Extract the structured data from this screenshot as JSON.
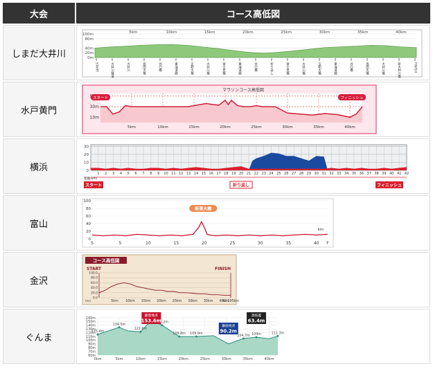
{
  "header": {
    "col_event": "大会",
    "col_course": "コース高低図"
  },
  "rows": [
    {
      "name": "しまだ大井川"
    },
    {
      "name": "水戸黄門"
    },
    {
      "name": "横浜"
    },
    {
      "name": "富山"
    },
    {
      "name": "金沢"
    },
    {
      "name": "ぐんま"
    }
  ],
  "colors": {
    "header_bg": "#333333",
    "name_bg": "#f5f5f5",
    "border": "#dcdcdc"
  },
  "chart_data": [
    {
      "type": "area",
      "event": "しまだ大井川",
      "y_ticks": [
        "100m",
        "80m",
        "40m",
        "20m",
        "0m"
      ],
      "x_ticks": [
        "5km",
        "10km",
        "15km",
        "20km",
        "25km",
        "30km",
        "35km",
        "40km"
      ],
      "ylim": [
        0,
        100
      ],
      "x": [
        0,
        2,
        4,
        6,
        8,
        10,
        12,
        14,
        16,
        18,
        20,
        22,
        24,
        26,
        28,
        30,
        32,
        34,
        36,
        38,
        40,
        42
      ],
      "values": [
        40,
        45,
        48,
        52,
        54,
        55,
        52,
        45,
        38,
        30,
        22,
        18,
        22,
        28,
        35,
        42,
        45,
        48,
        52,
        50,
        45,
        42
      ],
      "point_labels": [
        "START",
        "大井川鐵道",
        "大井川",
        "島田大橋",
        "谷口橋",
        "東海道線",
        "五和大橋",
        "大井川橋",
        "富士見橋",
        "東海道線",
        "谷口橋",
        "折り返し",
        "富士見橋",
        "大井川橋",
        "五和大橋",
        "東海道線",
        "谷口橋",
        "島田大橋",
        "大井川橋",
        "新大井川橋",
        "FINISH"
      ]
    },
    {
      "type": "line",
      "event": "水戸黄門",
      "title": "マラソンコース高低図",
      "start_label": "スタート",
      "finish_label": "フィニッシュ",
      "y_ticks": [
        "50m",
        "30m",
        "10m"
      ],
      "x_ticks": [
        "5km",
        "10km",
        "15km",
        "20km",
        "25km",
        "30km",
        "35km",
        "40km"
      ],
      "ylim": [
        0,
        55
      ],
      "x": [
        0,
        1,
        2,
        3,
        4,
        5,
        6,
        8,
        10,
        12,
        14,
        16,
        17,
        18,
        19,
        20,
        20.5,
        21,
        22,
        23,
        24,
        25,
        26,
        28,
        30,
        31,
        32,
        34,
        36,
        38,
        40,
        41,
        42
      ],
      "values": [
        30,
        30,
        16,
        20,
        32,
        30,
        30,
        30,
        30,
        30,
        30,
        34,
        36,
        34,
        33,
        42,
        34,
        42,
        32,
        30,
        30,
        32,
        30,
        30,
        18,
        17,
        16,
        14,
        17,
        15,
        10,
        16,
        30
      ]
    },
    {
      "type": "area",
      "event": "横浜",
      "y_ticks": [
        "30",
        "20",
        "10",
        "0"
      ],
      "x_ticks": [
        "1",
        "2",
        "3",
        "4",
        "5",
        "6",
        "7",
        "8",
        "9",
        "10",
        "11",
        "12",
        "13",
        "14",
        "15",
        "16",
        "17",
        "18",
        "19",
        "20",
        "21",
        "22",
        "23",
        "24",
        "25",
        "26",
        "27",
        "28",
        "29",
        "30",
        "31",
        "32",
        "33",
        "34",
        "35",
        "36",
        "37",
        "38",
        "39",
        "40",
        "41",
        "42"
      ],
      "x_axis_unit": "距離(km)",
      "ylim": [
        0,
        32
      ],
      "start_label": "スタート",
      "turn_label": "折り返し",
      "finish_label": "フィニッシュ",
      "series": [
        {
          "name": "",
          "x": [
            0,
            1,
            2,
            3,
            4,
            5,
            6,
            7,
            8,
            9,
            10,
            11,
            12,
            13,
            14,
            15,
            16,
            17,
            18,
            19,
            20,
            21,
            22,
            23,
            24,
            25,
            26,
            27,
            28,
            29,
            30,
            31,
            32,
            33,
            34,
            35,
            36,
            37,
            38,
            39,
            40,
            41,
            42
          ],
          "values": [
            3,
            3,
            2,
            3,
            2,
            3,
            2,
            2,
            3,
            3,
            2,
            3,
            2,
            3,
            4,
            3,
            2,
            2,
            3,
            4,
            5,
            2,
            2,
            2,
            2,
            2,
            2,
            2,
            2,
            2,
            2,
            2,
            3,
            2,
            3,
            2,
            3,
            2,
            2,
            3,
            2,
            3,
            4
          ]
        },
        {
          "name": "",
          "x": [
            21,
            21.5,
            22,
            23,
            24,
            25,
            26,
            27,
            28,
            29,
            30,
            31,
            31.5
          ],
          "values": [
            0,
            12,
            15,
            18,
            22,
            21,
            18,
            18,
            15,
            12,
            18,
            17,
            0
          ]
        }
      ]
    },
    {
      "type": "line",
      "event": "富山",
      "y_ticks": [
        "100",
        "80",
        "60",
        "40",
        "20",
        "0"
      ],
      "x_ticks": [
        "S",
        "5",
        "10",
        "15",
        "20",
        "25",
        "30",
        "35",
        "40",
        "F"
      ],
      "x_unit": "km",
      "ylim": [
        0,
        100
      ],
      "annotation": "新湊大橋",
      "x": [
        0,
        2,
        4,
        6,
        8,
        10,
        12,
        14,
        16,
        17,
        18,
        19,
        19.5,
        20,
        20.5,
        21,
        22,
        24,
        26,
        28,
        30,
        32,
        34,
        36,
        38,
        40,
        42
      ],
      "values": [
        10,
        8,
        10,
        8,
        12,
        10,
        8,
        10,
        8,
        10,
        12,
        30,
        45,
        30,
        12,
        10,
        8,
        10,
        8,
        10,
        8,
        10,
        8,
        10,
        12,
        10,
        12
      ]
    },
    {
      "type": "line",
      "event": "金沢",
      "title": "コース高低図",
      "start_label": "START",
      "finish_label": "FINISH",
      "y_ticks": [
        "100.0",
        "80.0",
        "60.0",
        "40.0",
        "20.0",
        "0.0"
      ],
      "y_unit": "(m)",
      "x_ticks": [
        "5km",
        "10km",
        "15km",
        "20km",
        "25km",
        "30km",
        "35km",
        "40km",
        "42.195km"
      ],
      "ylim": [
        0,
        100
      ],
      "x": [
        0,
        2,
        4,
        6,
        8,
        10,
        12,
        14,
        16,
        18,
        20,
        22,
        24,
        26,
        28,
        30,
        32,
        34,
        36,
        38,
        40,
        42.195
      ],
      "values": [
        20,
        30,
        45,
        55,
        60,
        55,
        45,
        40,
        35,
        30,
        30,
        25,
        25,
        20,
        20,
        18,
        15,
        15,
        12,
        12,
        10,
        10
      ]
    },
    {
      "type": "area",
      "event": "ぐんま",
      "y_ticks": [
        "160m",
        "150m",
        "140m",
        "130m",
        "120m",
        "110m",
        "100m",
        "90m",
        "80m",
        "70m",
        "60m"
      ],
      "x_ticks": [
        "0km",
        "5km",
        "10km",
        "15km",
        "20km",
        "25km",
        "30km",
        "35km",
        "40km"
      ],
      "ylim": [
        60,
        160
      ],
      "x": [
        0,
        5,
        7,
        10,
        12.5,
        15,
        19,
        23,
        27,
        30.5,
        34,
        37,
        40,
        42
      ],
      "values": [
        115.4,
        134.5,
        125,
        122.6,
        153.6,
        140.2,
        109.8,
        109.9,
        112,
        90.2,
        104.7,
        108,
        104,
        111.3
      ],
      "point_labels": [
        "115.4m",
        "134.5m",
        "122.6m",
        "140.2m",
        "109.8m",
        "109.9m",
        "104.7m",
        "104m",
        "111.3m"
      ],
      "max_label": "最高地点",
      "max_value": "153.6m",
      "min_label": "最低地点",
      "min_value": "90.2m",
      "diff_label": "高低差",
      "diff_value": "63.4m"
    }
  ]
}
